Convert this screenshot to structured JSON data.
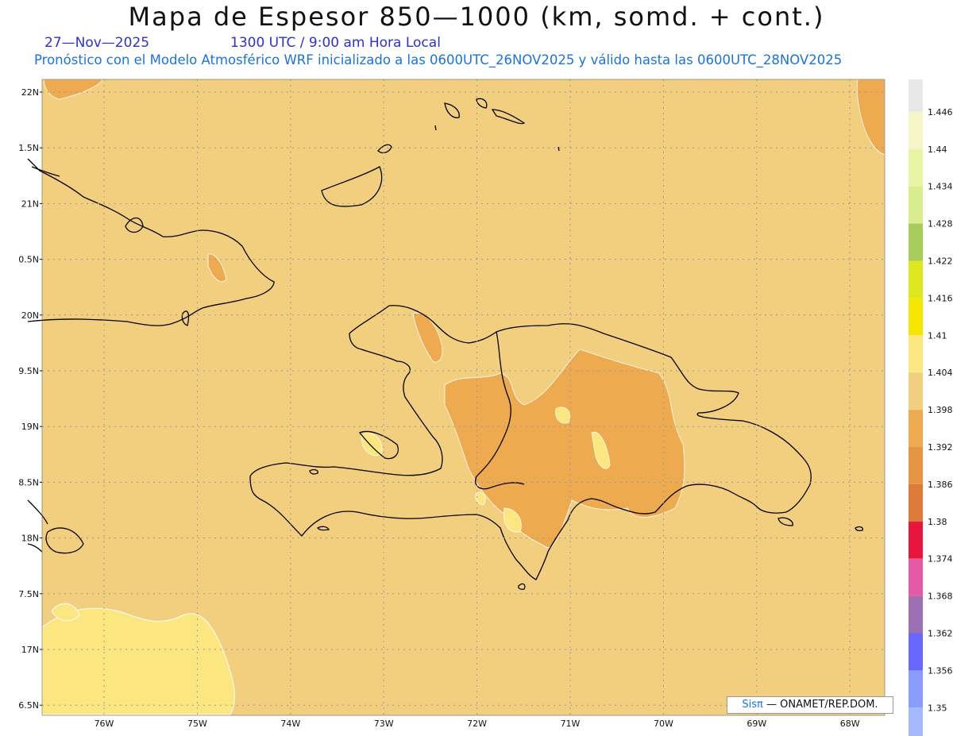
{
  "header": {
    "title": "Mapa de Espesor 850—1000 (km, somd. + cont.)",
    "date": "27—Nov—2025",
    "time": "1300 UTC / 9:00 am Hora Local",
    "forecast_line": "Pronóstico con el Modelo Atmosférico WRF inicializado a las 0600UTC_26NOV2025 y válido hasta las  0600UTC_28NOV2025"
  },
  "map": {
    "lat_labels": [
      "22N",
      "1.5N",
      "21N",
      "0.5N",
      "20N",
      "9.5N",
      "19N",
      "8.5N",
      "18N",
      "7.5N",
      "17N",
      "6.5N"
    ],
    "lon_labels": [
      "76W",
      "75W",
      "74W",
      "73W",
      "72W",
      "71W",
      "70W",
      "69W",
      "68W"
    ],
    "background_color": "#f2cf7e"
  },
  "legend": {
    "levels": [
      {
        "label": "1.446",
        "color": "#f5f5c8"
      },
      {
        "label": "1.44",
        "color": "#e9f3a4"
      },
      {
        "label": "1.434",
        "color": "#d8ee8e"
      },
      {
        "label": "1.428",
        "color": "#a8cc5c"
      },
      {
        "label": "1.422",
        "color": "#dfe81e"
      },
      {
        "label": "1.416",
        "color": "#f3e500"
      },
      {
        "label": "1.41",
        "color": "#fce680"
      },
      {
        "label": "1.404",
        "color": "#f2cf7e"
      },
      {
        "label": "1.398",
        "color": "#eeaa4e"
      },
      {
        "label": "1.392",
        "color": "#e79443"
      },
      {
        "label": "1.386",
        "color": "#de7a3a"
      },
      {
        "label": "1.38",
        "color": "#e8153c"
      },
      {
        "label": "1.374",
        "color": "#e55aa6"
      },
      {
        "label": "1.368",
        "color": "#9b6fb2"
      },
      {
        "label": "1.362",
        "color": "#6868ff"
      },
      {
        "label": "1.356",
        "color": "#8a9cff"
      },
      {
        "label": "1.35",
        "color": "#a4b8ff"
      }
    ],
    "top_color": "#e8e8e8",
    "bottom_color": "#c2d0ff"
  },
  "credit": {
    "brand": "Sisπ",
    "text": "— ONAMET/REP.DOM."
  }
}
